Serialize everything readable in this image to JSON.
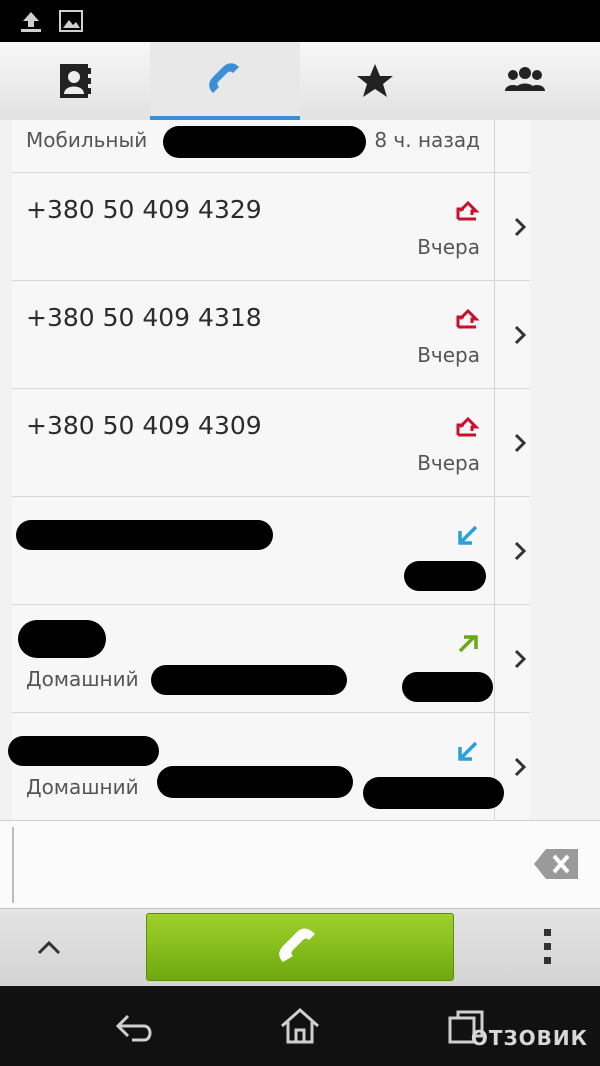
{
  "tabs": [
    {
      "icon": "contacts-book-icon"
    },
    {
      "icon": "phone-icon",
      "active": true
    },
    {
      "icon": "star-icon"
    },
    {
      "icon": "groups-icon"
    }
  ],
  "call_log": [
    {
      "label_type": "Мобильный",
      "time": "8 ч. назад",
      "call_type": "incoming-arrow-icon"
    },
    {
      "number": "+380 50 409 4329",
      "time": "Вчера",
      "call_type": "missed-call-icon"
    },
    {
      "number": "+380 50 409 4318",
      "time": "Вчера",
      "call_type": "missed-call-icon"
    },
    {
      "number": "+380 50 409 4309",
      "time": "Вчера",
      "call_type": "missed-call-icon"
    },
    {
      "call_type": "incoming-call-icon"
    },
    {
      "label_type": "Домашний",
      "call_type": "outgoing-call-icon"
    },
    {
      "label_type": "Домашний",
      "call_type": "incoming-call-icon"
    }
  ],
  "watermark": "ОТЗОВИК"
}
